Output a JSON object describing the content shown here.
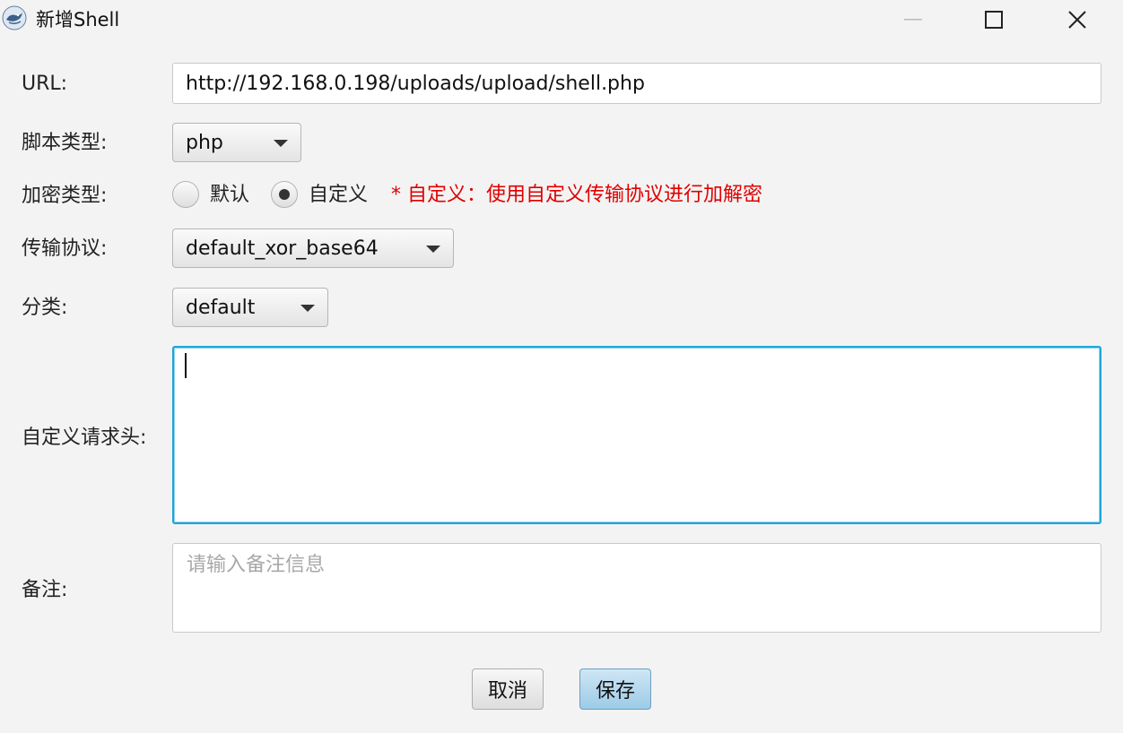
{
  "window": {
    "title": "新增Shell"
  },
  "form": {
    "url_label": "URL:",
    "url_value": "http://192.168.0.198/uploads/upload/shell.php",
    "script_type_label": "脚本类型:",
    "script_type_value": "php",
    "encrypt_type_label": "加密类型:",
    "encrypt_options": [
      {
        "label": "默认",
        "selected": false
      },
      {
        "label": "自定义",
        "selected": true
      }
    ],
    "encrypt_hint": "* 自定义：使用自定义传输协议进行加解密",
    "protocol_label": "传输协议:",
    "protocol_value": "default_xor_base64",
    "category_label": "分类:",
    "category_value": "default",
    "headers_label": "自定义请求头:",
    "headers_value": "",
    "note_label": "备注:",
    "note_placeholder": "请输入备注信息"
  },
  "buttons": {
    "cancel": "取消",
    "save": "保存"
  },
  "colors": {
    "hint": "#e00000",
    "focus_border": "#1ea6d8",
    "save_button": "#9ccbe6"
  }
}
